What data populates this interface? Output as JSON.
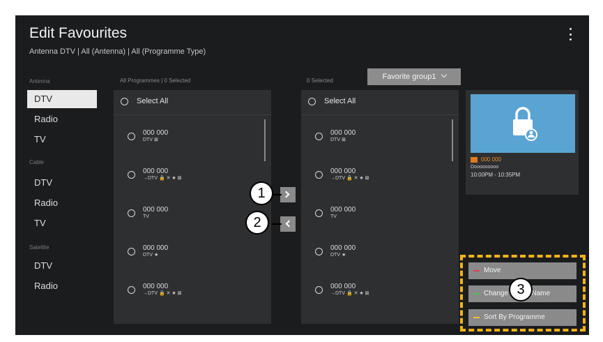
{
  "header": {
    "title": "Edit Favourites",
    "subtitle": "Antenna DTV | All (Antenna) | All (Programme Type)"
  },
  "sidebar": {
    "groups": [
      {
        "label": "Antenna",
        "items": [
          "DTV",
          "Radio",
          "TV"
        ]
      },
      {
        "label": "Cable",
        "items": [
          "DTV",
          "Radio",
          "TV"
        ]
      },
      {
        "label": "Satellite",
        "items": [
          "DTV",
          "Radio"
        ]
      }
    ]
  },
  "left_panel": {
    "header": "All Programmes | 0 Selected",
    "select_all": "Select All",
    "rows": [
      {
        "number": "000 000",
        "info": "DTV ⊠"
      },
      {
        "number": "000 000",
        "info": "→DTV 🔒 ✕ ★ ⊠"
      },
      {
        "number": "000 000",
        "info": "TV"
      },
      {
        "number": "000 000",
        "info": "DTV ★"
      },
      {
        "number": "000 000",
        "info": "→DTV 🔒 ✕ ★ ⊠"
      }
    ]
  },
  "right_panel": {
    "header": "0 Selected",
    "group_button": "Favorite group1",
    "select_all": "Select All",
    "rows": [
      {
        "number": "000 000",
        "info": "DTV ⊠"
      },
      {
        "number": "000 000",
        "info": "→DTV 🔒 ✕ ★ ⊠"
      },
      {
        "number": "000 000",
        "info": "TV"
      },
      {
        "number": "000 000",
        "info": "DTV ★"
      },
      {
        "number": "000 000",
        "info": "→DTV 🔒 ✕ ★ ⊠"
      }
    ]
  },
  "callouts": [
    "1",
    "2",
    "3"
  ],
  "preview": {
    "channel_number": "000 000",
    "programme_name": "Dooooooooo",
    "time": "10:00PM - 10:35PM"
  },
  "actions": [
    {
      "label": "Move",
      "color": "#e0405a"
    },
    {
      "label": "Change Group Name",
      "color": "#4fc05a"
    },
    {
      "label": "Sort By Programme",
      "color": "#f2c230"
    }
  ],
  "colors": {
    "highlight": "#f3b316",
    "thumb": "#5aa4d3",
    "channel_accent": "#e8902a"
  }
}
